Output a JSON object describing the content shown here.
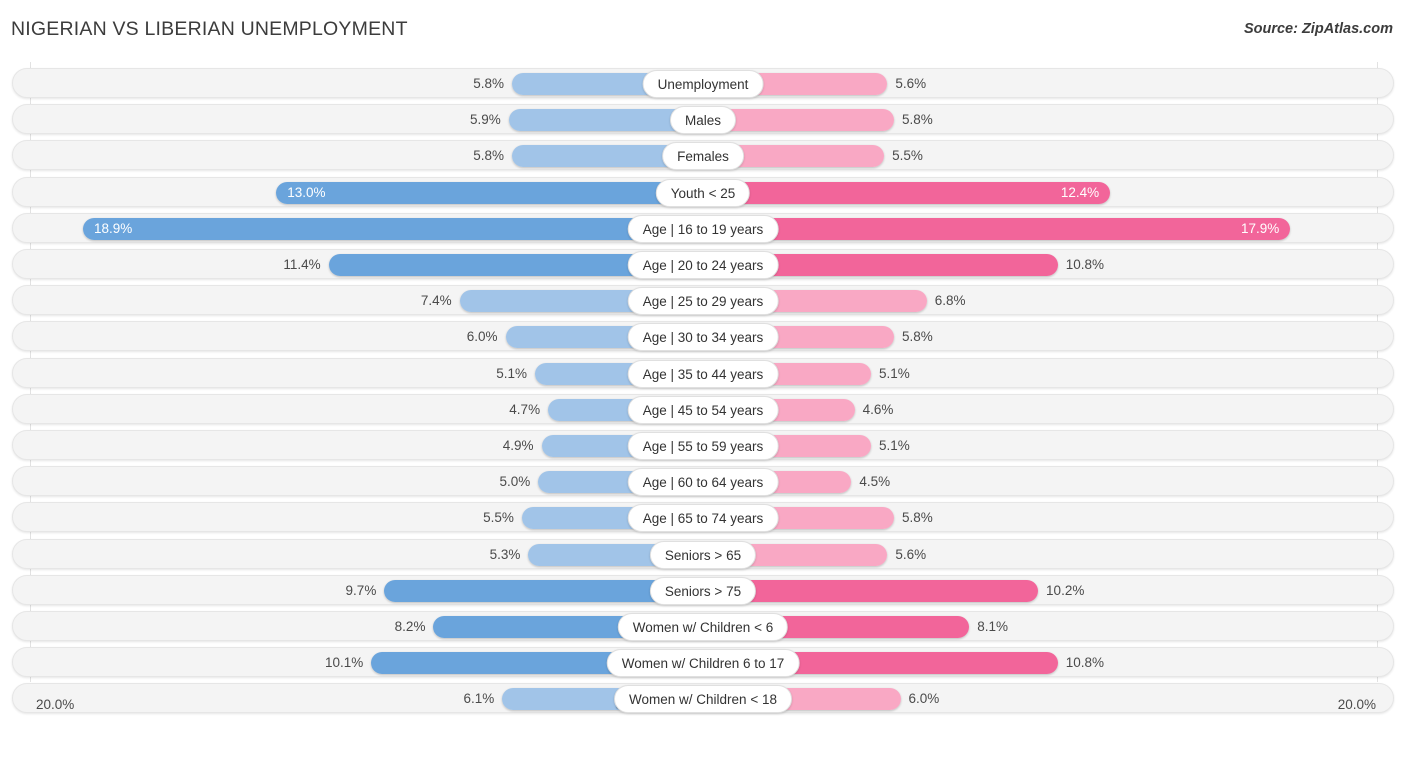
{
  "title": "NIGERIAN VS LIBERIAN UNEMPLOYMENT",
  "source": "Source: ZipAtlas.com",
  "axis": {
    "left_label": "20.0%",
    "right_label": "20.0%"
  },
  "legend": [
    {
      "label": "Nigerian",
      "color": "#6aa4dc"
    },
    {
      "label": "Liberian",
      "color": "#f2659a"
    }
  ],
  "colors": {
    "left_light": "#a1c4e8",
    "left_dark": "#6aa4dc",
    "right_light": "#f9a8c4",
    "right_dark": "#f2659a",
    "row_track": "#f4f4f4",
    "gridline": "#e2e2e2"
  },
  "chart_data": {
    "type": "bar",
    "title": "NIGERIAN VS LIBERIAN UNEMPLOYMENT",
    "subtitle": "Source: ZipAtlas.com",
    "orientation": "horizontal-diverging",
    "xlabel": "",
    "ylabel": "",
    "xlim": [
      0,
      20
    ],
    "axis_max": 20.0,
    "axis_unit": "%",
    "grid": true,
    "legend_position": "bottom-center",
    "categories": [
      "Unemployment",
      "Males",
      "Females",
      "Youth < 25",
      "Age | 16 to 19 years",
      "Age | 20 to 24 years",
      "Age | 25 to 29 years",
      "Age | 30 to 34 years",
      "Age | 35 to 44 years",
      "Age | 45 to 54 years",
      "Age | 55 to 59 years",
      "Age | 60 to 64 years",
      "Age | 65 to 74 years",
      "Seniors > 65",
      "Seniors > 75",
      "Women w/ Children < 6",
      "Women w/ Children 6 to 17",
      "Women w/ Children < 18"
    ],
    "series": [
      {
        "name": "Nigerian",
        "color": "#6aa4dc",
        "values": [
          5.8,
          5.9,
          5.8,
          13.0,
          18.9,
          11.4,
          7.4,
          6.0,
          5.1,
          4.7,
          4.9,
          5.0,
          5.5,
          5.3,
          9.7,
          8.2,
          10.1,
          6.1
        ]
      },
      {
        "name": "Liberian",
        "color": "#f2659a",
        "values": [
          5.6,
          5.8,
          5.5,
          12.4,
          17.9,
          10.8,
          6.8,
          5.8,
          5.1,
          4.6,
          5.1,
          4.5,
          5.8,
          5.6,
          10.2,
          8.1,
          10.8,
          6.0
        ]
      }
    ]
  },
  "rows": [
    {
      "label": "Unemployment",
      "left": {
        "text": "5.8%",
        "value": 5.8,
        "inside": false,
        "dark": false
      },
      "right": {
        "text": "5.6%",
        "value": 5.6,
        "inside": false,
        "dark": false
      }
    },
    {
      "label": "Males",
      "left": {
        "text": "5.9%",
        "value": 5.9,
        "inside": false,
        "dark": false
      },
      "right": {
        "text": "5.8%",
        "value": 5.8,
        "inside": false,
        "dark": false
      }
    },
    {
      "label": "Females",
      "left": {
        "text": "5.8%",
        "value": 5.8,
        "inside": false,
        "dark": false
      },
      "right": {
        "text": "5.5%",
        "value": 5.5,
        "inside": false,
        "dark": false
      }
    },
    {
      "label": "Youth < 25",
      "left": {
        "text": "13.0%",
        "value": 13.0,
        "inside": true,
        "dark": true
      },
      "right": {
        "text": "12.4%",
        "value": 12.4,
        "inside": true,
        "dark": true
      }
    },
    {
      "label": "Age | 16 to 19 years",
      "left": {
        "text": "18.9%",
        "value": 18.9,
        "inside": true,
        "dark": true
      },
      "right": {
        "text": "17.9%",
        "value": 17.9,
        "inside": true,
        "dark": true
      }
    },
    {
      "label": "Age | 20 to 24 years",
      "left": {
        "text": "11.4%",
        "value": 11.4,
        "inside": false,
        "dark": true
      },
      "right": {
        "text": "10.8%",
        "value": 10.8,
        "inside": false,
        "dark": true
      }
    },
    {
      "label": "Age | 25 to 29 years",
      "left": {
        "text": "7.4%",
        "value": 7.4,
        "inside": false,
        "dark": false
      },
      "right": {
        "text": "6.8%",
        "value": 6.8,
        "inside": false,
        "dark": false
      }
    },
    {
      "label": "Age | 30 to 34 years",
      "left": {
        "text": "6.0%",
        "value": 6.0,
        "inside": false,
        "dark": false
      },
      "right": {
        "text": "5.8%",
        "value": 5.8,
        "inside": false,
        "dark": false
      }
    },
    {
      "label": "Age | 35 to 44 years",
      "left": {
        "text": "5.1%",
        "value": 5.1,
        "inside": false,
        "dark": false
      },
      "right": {
        "text": "5.1%",
        "value": 5.1,
        "inside": false,
        "dark": false
      }
    },
    {
      "label": "Age | 45 to 54 years",
      "left": {
        "text": "4.7%",
        "value": 4.7,
        "inside": false,
        "dark": false
      },
      "right": {
        "text": "4.6%",
        "value": 4.6,
        "inside": false,
        "dark": false
      }
    },
    {
      "label": "Age | 55 to 59 years",
      "left": {
        "text": "4.9%",
        "value": 4.9,
        "inside": false,
        "dark": false
      },
      "right": {
        "text": "5.1%",
        "value": 5.1,
        "inside": false,
        "dark": false
      }
    },
    {
      "label": "Age | 60 to 64 years",
      "left": {
        "text": "5.0%",
        "value": 5.0,
        "inside": false,
        "dark": false
      },
      "right": {
        "text": "4.5%",
        "value": 4.5,
        "inside": false,
        "dark": false
      }
    },
    {
      "label": "Age | 65 to 74 years",
      "left": {
        "text": "5.5%",
        "value": 5.5,
        "inside": false,
        "dark": false
      },
      "right": {
        "text": "5.8%",
        "value": 5.8,
        "inside": false,
        "dark": false
      }
    },
    {
      "label": "Seniors > 65",
      "left": {
        "text": "5.3%",
        "value": 5.3,
        "inside": false,
        "dark": false
      },
      "right": {
        "text": "5.6%",
        "value": 5.6,
        "inside": false,
        "dark": false
      }
    },
    {
      "label": "Seniors > 75",
      "left": {
        "text": "9.7%",
        "value": 9.7,
        "inside": false,
        "dark": true
      },
      "right": {
        "text": "10.2%",
        "value": 10.2,
        "inside": false,
        "dark": true
      }
    },
    {
      "label": "Women w/ Children < 6",
      "left": {
        "text": "8.2%",
        "value": 8.2,
        "inside": false,
        "dark": true
      },
      "right": {
        "text": "8.1%",
        "value": 8.1,
        "inside": false,
        "dark": true
      }
    },
    {
      "label": "Women w/ Children 6 to 17",
      "left": {
        "text": "10.1%",
        "value": 10.1,
        "inside": false,
        "dark": true
      },
      "right": {
        "text": "10.8%",
        "value": 10.8,
        "inside": false,
        "dark": true
      }
    },
    {
      "label": "Women w/ Children < 18",
      "left": {
        "text": "6.1%",
        "value": 6.1,
        "inside": false,
        "dark": false
      },
      "right": {
        "text": "6.0%",
        "value": 6.0,
        "inside": false,
        "dark": false
      }
    }
  ]
}
